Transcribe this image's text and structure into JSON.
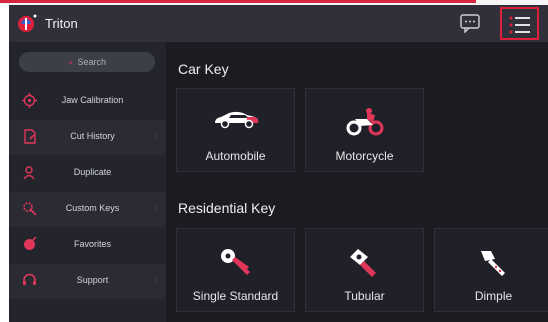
{
  "header": {
    "title": "Triton"
  },
  "sidebar": {
    "search_label": "Search",
    "items": [
      {
        "label": "Jaw Calibration",
        "icon": "target-icon"
      },
      {
        "label": "Cut History",
        "icon": "document-icon"
      },
      {
        "label": "Duplicate",
        "icon": "user-key-icon"
      },
      {
        "label": "Custom Keys",
        "icon": "gear-key-icon"
      },
      {
        "label": "Favorites",
        "icon": "heart-icon"
      },
      {
        "label": "Support",
        "icon": "headset-icon"
      }
    ]
  },
  "main": {
    "car_section": {
      "title": "Car Key",
      "cards": [
        {
          "label": "Automobile",
          "icon": "car-icon"
        },
        {
          "label": "Motorcycle",
          "icon": "motorcycle-icon"
        }
      ]
    },
    "residential_section": {
      "title": "Residential Key",
      "cards": [
        {
          "label": "Single Standard",
          "icon": "standard-key-icon"
        },
        {
          "label": "Tubular",
          "icon": "tubular-key-icon"
        },
        {
          "label": "Dimple",
          "icon": "dimple-key-icon"
        }
      ]
    }
  },
  "colors": {
    "accent": "#e0203a",
    "background": "#1e1f26",
    "header": "#2f3039"
  }
}
